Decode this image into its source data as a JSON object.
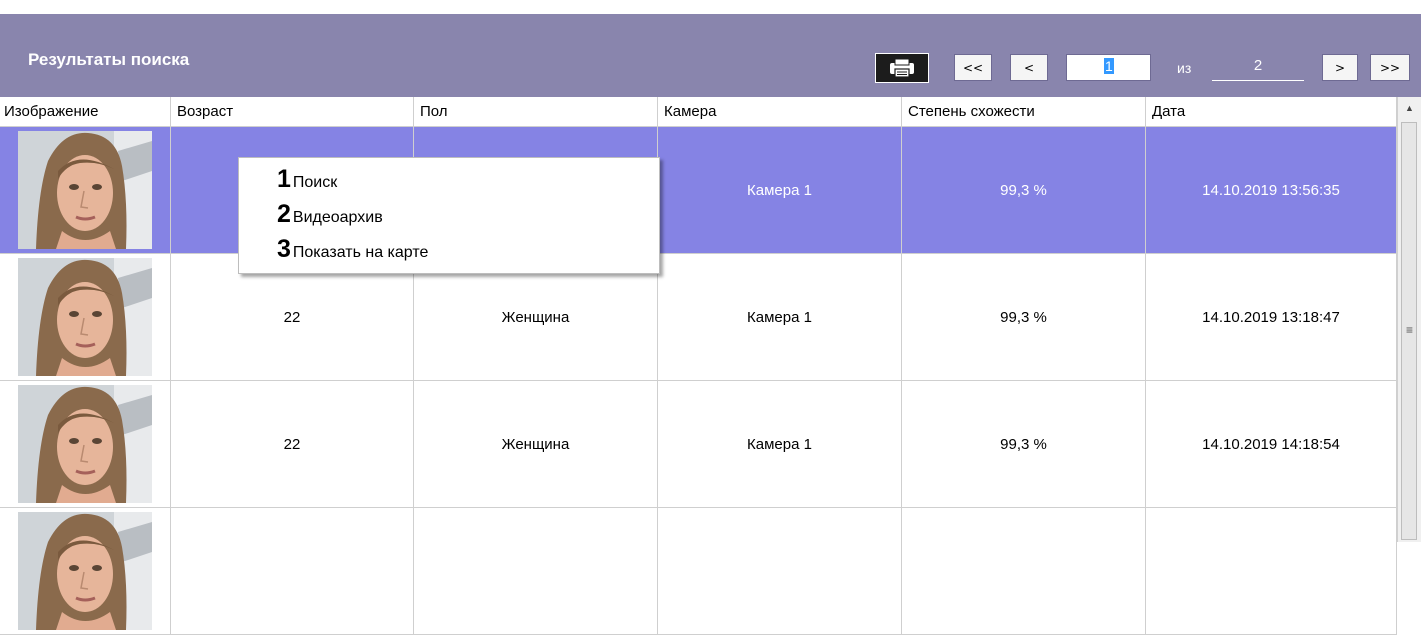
{
  "header": {
    "title": "Результаты поиска",
    "first_label": "<<",
    "prev_label": "<",
    "current_page": "1",
    "of_label": "из",
    "total_pages": "2",
    "next_label": ">",
    "last_label": ">>",
    "print_icon": "print-icon"
  },
  "columns": [
    "Изображение",
    "Возраст",
    "Пол",
    "Камера",
    "Степень схожести",
    "Дата"
  ],
  "rows": [
    {
      "age": "",
      "gender": "",
      "camera": "Камера 1",
      "similarity": "99,3 %",
      "date": "14.10.2019 13:56:35",
      "selected": true
    },
    {
      "age": "22",
      "gender": "Женщина",
      "camera": "Камера 1",
      "similarity": "99,3 %",
      "date": "14.10.2019 13:18:47",
      "selected": false
    },
    {
      "age": "22",
      "gender": "Женщина",
      "camera": "Камера 1",
      "similarity": "99,3 %",
      "date": "14.10.2019 14:18:54",
      "selected": false
    },
    {
      "age": "",
      "gender": "",
      "camera": "",
      "similarity": "",
      "date": "",
      "selected": false
    }
  ],
  "context_menu": [
    {
      "num": "1",
      "label": "Поиск"
    },
    {
      "num": "2",
      "label": "Видеоархив"
    },
    {
      "num": "3",
      "label": "Показать на карте"
    }
  ],
  "colors": {
    "header_bg": "#8985ad",
    "selected_row": "#8583e4"
  }
}
